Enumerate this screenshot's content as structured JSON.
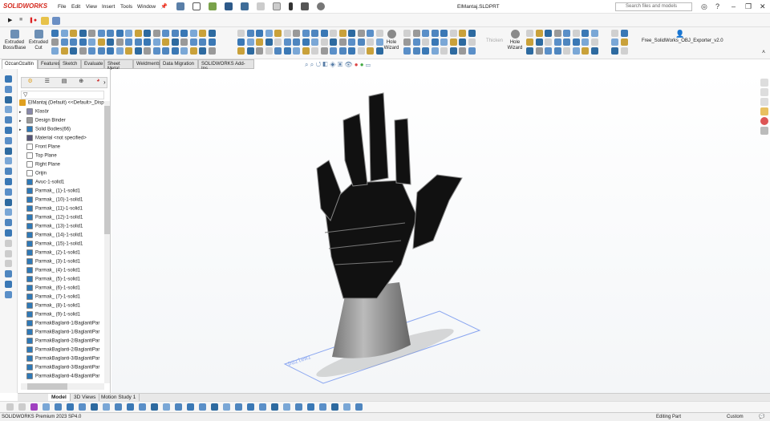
{
  "app": {
    "logo": "SOLIDWORKS",
    "document_title": "ElMantaj.SLDPRT",
    "search_placeholder": "Search files and models"
  },
  "menu": [
    "File",
    "Edit",
    "View",
    "Insert",
    "Tools",
    "Window"
  ],
  "ribbon": {
    "extruded_boss": "Extruded Boss/Base",
    "extruded_cut": "Extruded Cut",
    "hole_wizard_1": "Hole Wizard",
    "thicken": "Thicken",
    "hole_wizard_2": "Hole Wizard",
    "addin": "Free_SolidWorks_OBJ_Exporter_v2.0"
  },
  "tabs": [
    "OzcanOzaltin",
    "Features",
    "Sketch",
    "Evaluate",
    "Sheet Metal",
    "Weldments",
    "Data Migration",
    "SOLIDWORKS Add-Ins"
  ],
  "tree": {
    "root": "ElMantaj (Default) <<Default>_Disp",
    "items": [
      {
        "label": "Klasör",
        "icon": "folder-icon",
        "expand": true
      },
      {
        "label": "Design Binder",
        "icon": "binder-icon",
        "expand": true
      },
      {
        "label": "Solid Bodies(66)",
        "icon": "solid-bodies-icon",
        "expand": true
      },
      {
        "label": "Material <not specified>",
        "icon": "material-icon"
      },
      {
        "label": "Front Plane",
        "icon": "plane-icon"
      },
      {
        "label": "Top Plane",
        "icon": "plane-icon"
      },
      {
        "label": "Right Plane",
        "icon": "plane-icon"
      },
      {
        "label": "Orijin",
        "icon": "origin-icon"
      },
      {
        "label": "Avuc-1-solid1",
        "icon": "body-icon"
      },
      {
        "label": "Parmak_ (1)-1-solid1",
        "icon": "body-icon"
      },
      {
        "label": "Parmak_ (10)-1-solid1",
        "icon": "body-icon"
      },
      {
        "label": "Parmak_ (11)-1-solid1",
        "icon": "body-icon"
      },
      {
        "label": "Parmak_ (12)-1-solid1",
        "icon": "body-icon"
      },
      {
        "label": "Parmak_ (13)-1-solid1",
        "icon": "body-icon"
      },
      {
        "label": "Parmak_ (14)-1-solid1",
        "icon": "body-icon"
      },
      {
        "label": "Parmak_ (15)-1-solid1",
        "icon": "body-icon"
      },
      {
        "label": "Parmak_ (2)-1-solid1",
        "icon": "body-icon"
      },
      {
        "label": "Parmak_ (3)-1-solid1",
        "icon": "body-icon"
      },
      {
        "label": "Parmak_ (4)-1-solid1",
        "icon": "body-icon"
      },
      {
        "label": "Parmak_ (5)-1-solid1",
        "icon": "body-icon"
      },
      {
        "label": "Parmak_ (6)-1-solid1",
        "icon": "body-icon"
      },
      {
        "label": "Parmak_ (7)-1-solid1",
        "icon": "body-icon"
      },
      {
        "label": "Parmak_ (8)-1-solid1",
        "icon": "body-icon"
      },
      {
        "label": "Parmak_ (9)-1-solid1",
        "icon": "body-icon"
      },
      {
        "label": "ParmakBaglanti-1/BaglantiPar",
        "icon": "body-icon"
      },
      {
        "label": "ParmakBaglanti-1/BaglantiPar",
        "icon": "body-icon"
      },
      {
        "label": "ParmakBaglanti-2/BaglantiPar",
        "icon": "body-icon"
      },
      {
        "label": "ParmakBaglanti-2/BaglantiPar",
        "icon": "body-icon"
      },
      {
        "label": "ParmakBaglanti-3/BaglantiPar",
        "icon": "body-icon"
      },
      {
        "label": "ParmakBaglanti-3/BaglantiPar",
        "icon": "body-icon"
      },
      {
        "label": "ParmakBaglanti-4/BaglantiPar",
        "icon": "body-icon"
      }
    ]
  },
  "viewport": {
    "plane_label": "Düzlem1"
  },
  "bottom_tabs": [
    "Model",
    "3D Views",
    "Motion Study 1"
  ],
  "status": {
    "product": "SOLIDWORKS Premium 2023 SP4.0",
    "mode": "Editing Part",
    "units": "Custom"
  },
  "colors": {
    "brand": "#d42a1f",
    "body_icon": "#2f79b6",
    "plane": "#8aa6f0"
  }
}
